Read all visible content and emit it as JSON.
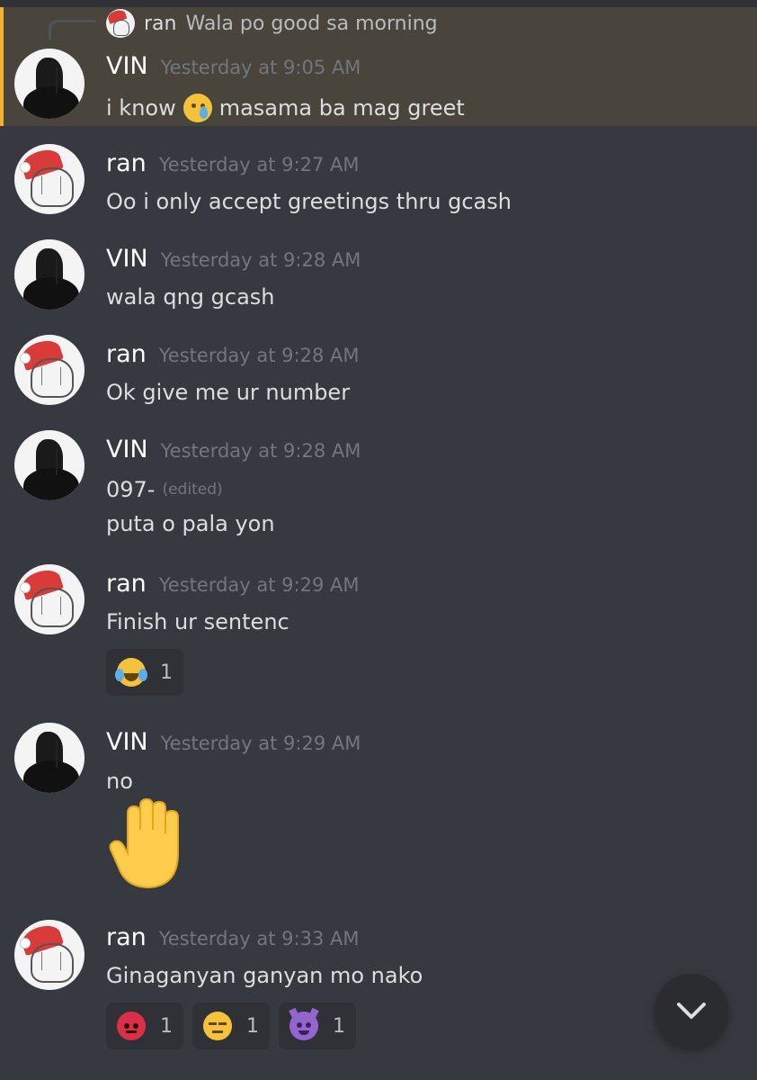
{
  "reply": {
    "author": "ran",
    "text": "Wala po good sa morning"
  },
  "messages": [
    {
      "author": "VIN",
      "time": "Yesterday at 9:05 AM",
      "lines": [
        "i know",
        "masama ba mag greet"
      ]
    },
    {
      "author": "ran",
      "time": "Yesterday at 9:27 AM",
      "lines": [
        "Oo i only accept greetings thru gcash"
      ]
    },
    {
      "author": "VIN",
      "time": "Yesterday at 9:28 AM",
      "lines": [
        "wala qng gcash"
      ]
    },
    {
      "author": "ran",
      "time": "Yesterday at 9:28 AM",
      "lines": [
        "Ok give me ur number"
      ]
    },
    {
      "author": "VIN",
      "time": "Yesterday at 9:28 AM",
      "lines": [
        "097-",
        "puta o pala yon"
      ],
      "edited": "(edited)"
    },
    {
      "author": "ran",
      "time": "Yesterday at 9:29 AM",
      "lines": [
        "Finish ur sentenc"
      ],
      "reactions": [
        {
          "emoji": "joy",
          "count": "1"
        }
      ]
    },
    {
      "author": "VIN",
      "time": "Yesterday at 9:29 AM",
      "lines": [
        "no"
      ],
      "big_emoji": "raised-hand"
    },
    {
      "author": "ran",
      "time": "Yesterday at 9:33 AM",
      "lines": [
        "Ginaganyan ganyan mo nako"
      ],
      "reactions": [
        {
          "emoji": "angry",
          "count": "1"
        },
        {
          "emoji": "unamused",
          "count": "1"
        },
        {
          "emoji": "imp",
          "count": "1"
        }
      ]
    }
  ],
  "scroll_button": {
    "icon": "chevron-down-icon"
  },
  "colors": {
    "background": "#36393f",
    "highlight": "#49443c",
    "highlight_border": "#f0b232",
    "author": "#ffffff",
    "timestamp": "#72767d",
    "text": "#dcddde"
  }
}
